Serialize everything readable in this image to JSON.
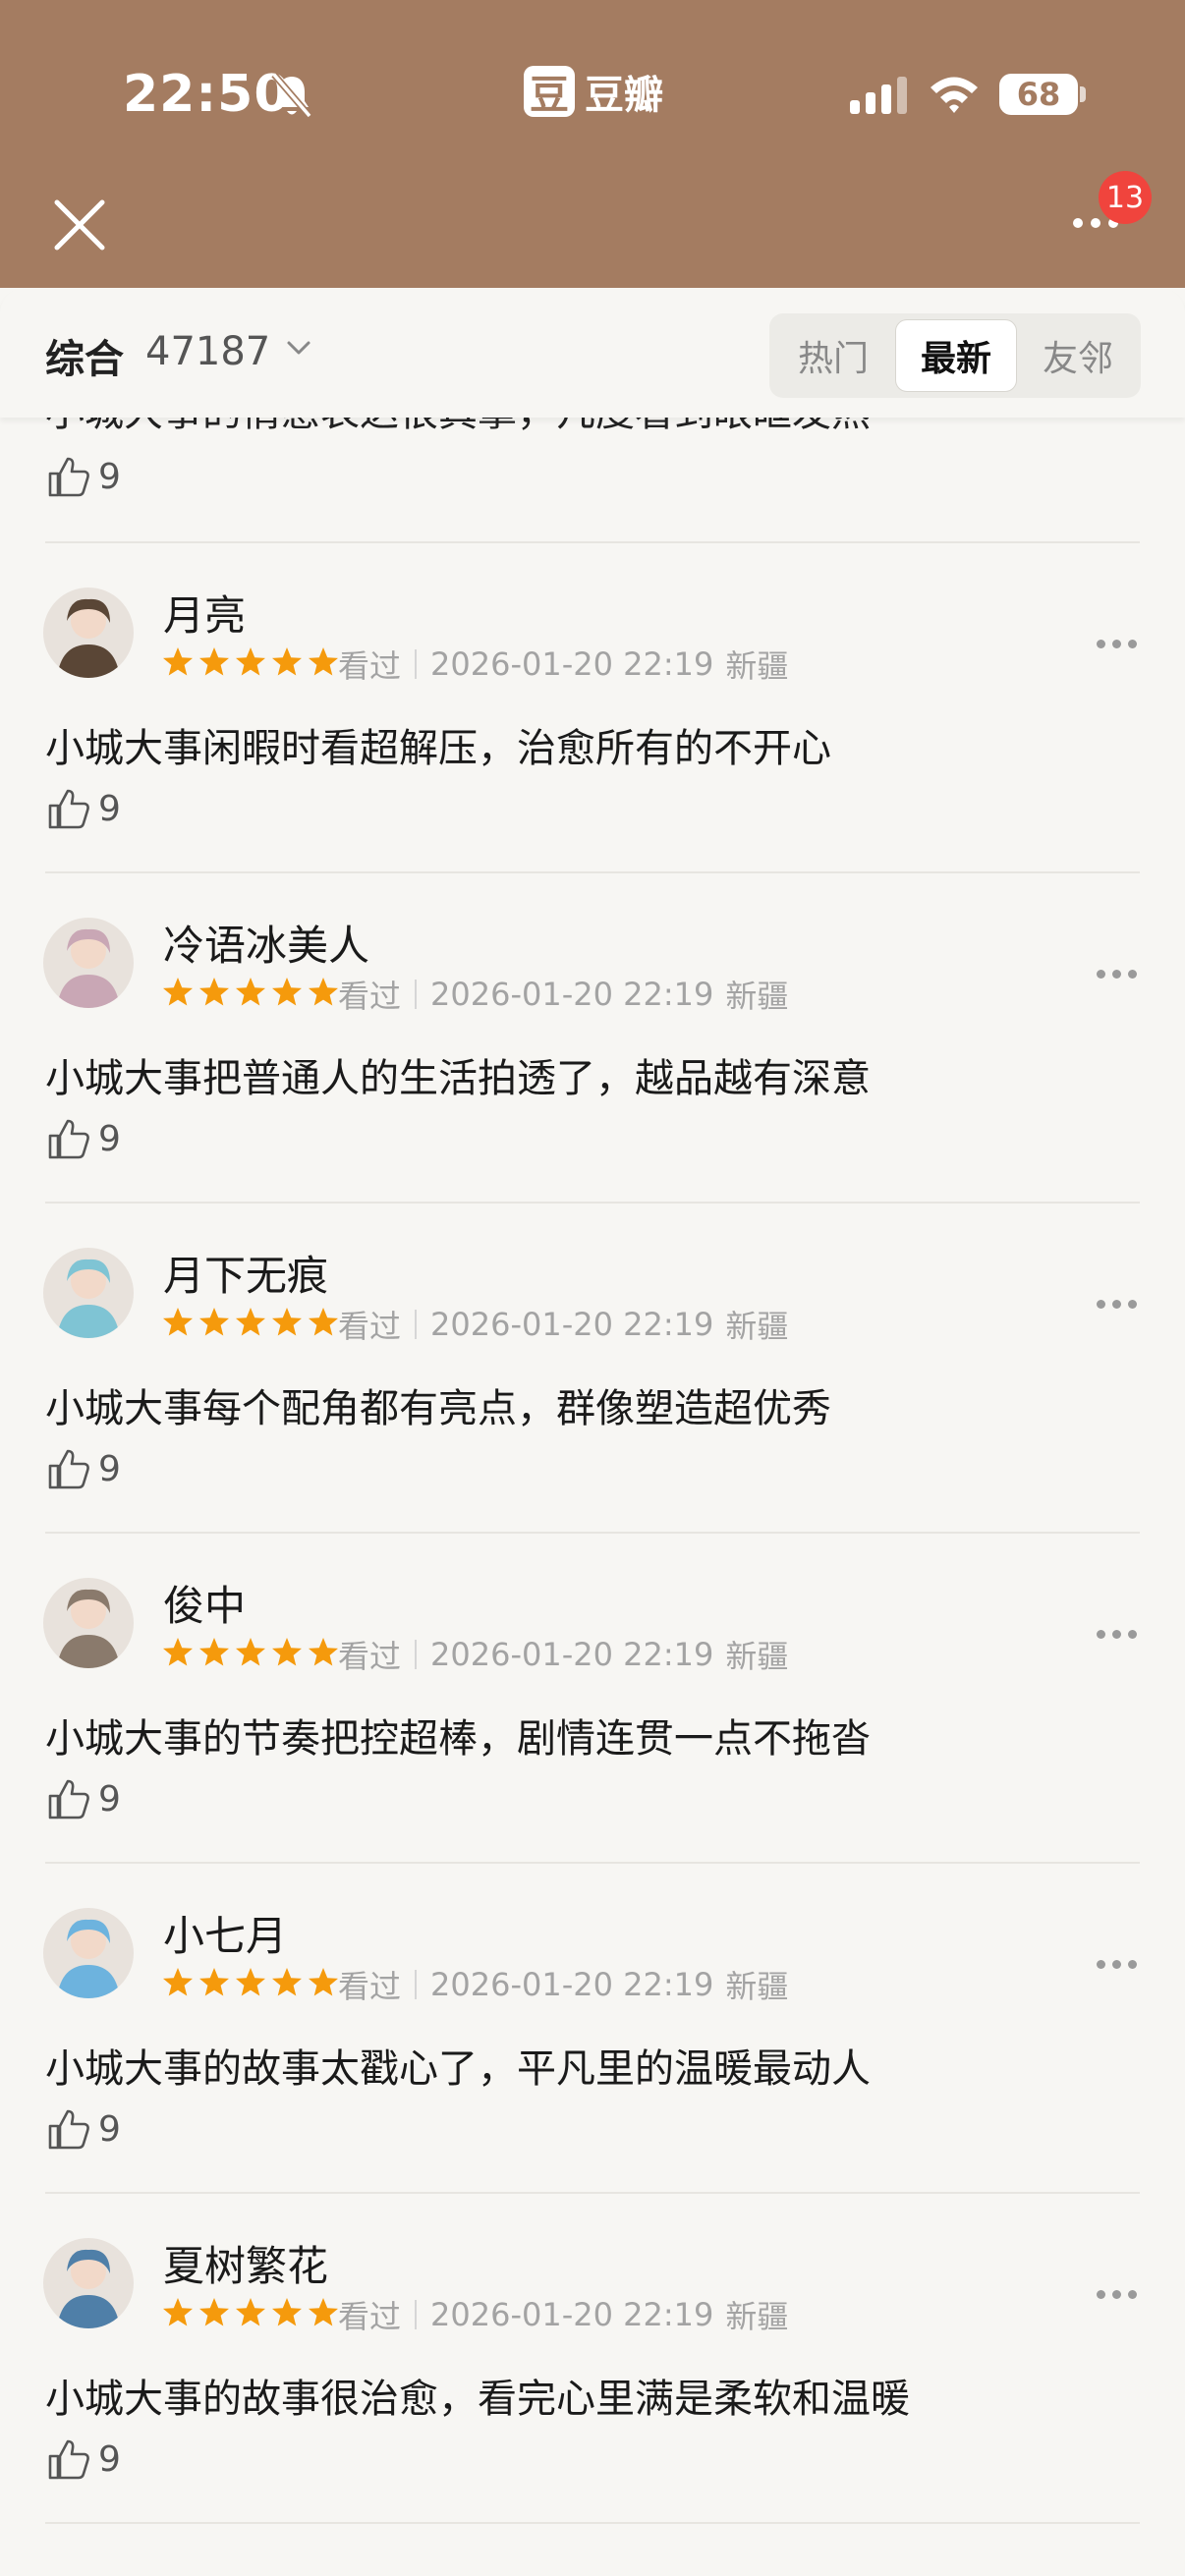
{
  "status_bar": {
    "time": "22:50",
    "app_name": "豆瓣",
    "app_logo_char": "豆",
    "battery": "68"
  },
  "header": {
    "badge_count": "13"
  },
  "sort_bar": {
    "label": "综合",
    "count": "47187",
    "tabs": [
      "热门",
      "最新",
      "友邻"
    ],
    "active_tab": "最新"
  },
  "feed": {
    "partial_text": "小城大事的情感表达很真挚，几度看到眼眶发热",
    "partial_likes": "9",
    "reviews": [
      {
        "username": "月亮",
        "status": "看过",
        "date": "2026-01-20 22:19",
        "location": "新疆",
        "rating": 5,
        "content": "小城大事闲暇时看超解压，治愈所有的不开心",
        "likes": "9",
        "avatar_color": "#5a4636"
      },
      {
        "username": "冷语冰美人",
        "status": "看过",
        "date": "2026-01-20 22:19",
        "location": "新疆",
        "rating": 5,
        "content": "小城大事把普通人的生活拍透了，越品越有深意",
        "likes": "9",
        "avatar_color": "#c9a7b5"
      },
      {
        "username": "月下无痕",
        "status": "看过",
        "date": "2026-01-20 22:19",
        "location": "新疆",
        "rating": 5,
        "content": "小城大事每个配角都有亮点，群像塑造超优秀",
        "likes": "9",
        "avatar_color": "#7fc4d4"
      },
      {
        "username": "俊中",
        "status": "看过",
        "date": "2026-01-20 22:19",
        "location": "新疆",
        "rating": 5,
        "content": "小城大事的节奏把控超棒，剧情连贯一点不拖沓",
        "likes": "9",
        "avatar_color": "#8a7a6c"
      },
      {
        "username": "小七月",
        "status": "看过",
        "date": "2026-01-20 22:19",
        "location": "新疆",
        "rating": 5,
        "content": "小城大事的故事太戳心了，平凡里的温暖最动人",
        "likes": "9",
        "avatar_color": "#6db3de"
      },
      {
        "username": "夏树繁花",
        "status": "看过",
        "date": "2026-01-20 22:19",
        "location": "新疆",
        "rating": 5,
        "content": "小城大事的故事很治愈，看完心里满是柔软和温暖",
        "likes": "9",
        "avatar_color": "#4f7fa8"
      }
    ]
  },
  "colors": {
    "header_bg": "#a47c61",
    "star": "#f59a0c",
    "badge": "#f0443d",
    "page_bg": "#f7f6f3"
  }
}
